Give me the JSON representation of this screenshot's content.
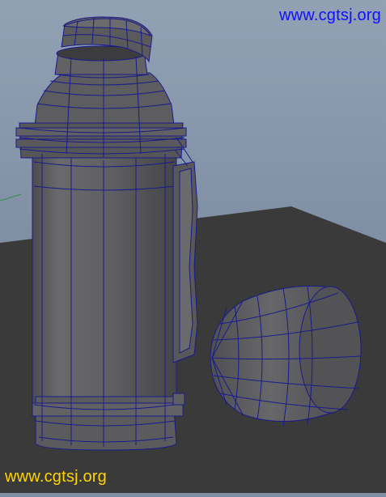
{
  "scene": {
    "objects": [
      "thermos-bottle",
      "thermos-handle",
      "thermos-lid",
      "thermos-cup"
    ],
    "display_mode": "wireframe-on-shaded",
    "colors": {
      "background_top": "#8e9db0",
      "background_bottom": "#6f7f95",
      "floor": "#3a3a3b",
      "object_fill": "#5e5e61",
      "object_shadow": "#3f3f42",
      "object_highlight": "#77777a",
      "wireframe": "#1a1a8c",
      "wireframe_dark": "#101060"
    }
  },
  "watermarks": {
    "top": {
      "text": "www.cgtsj.org",
      "color": "#1010ff"
    },
    "bottom": {
      "text": "www.cgtsj.org",
      "color": "#ffd400"
    }
  }
}
